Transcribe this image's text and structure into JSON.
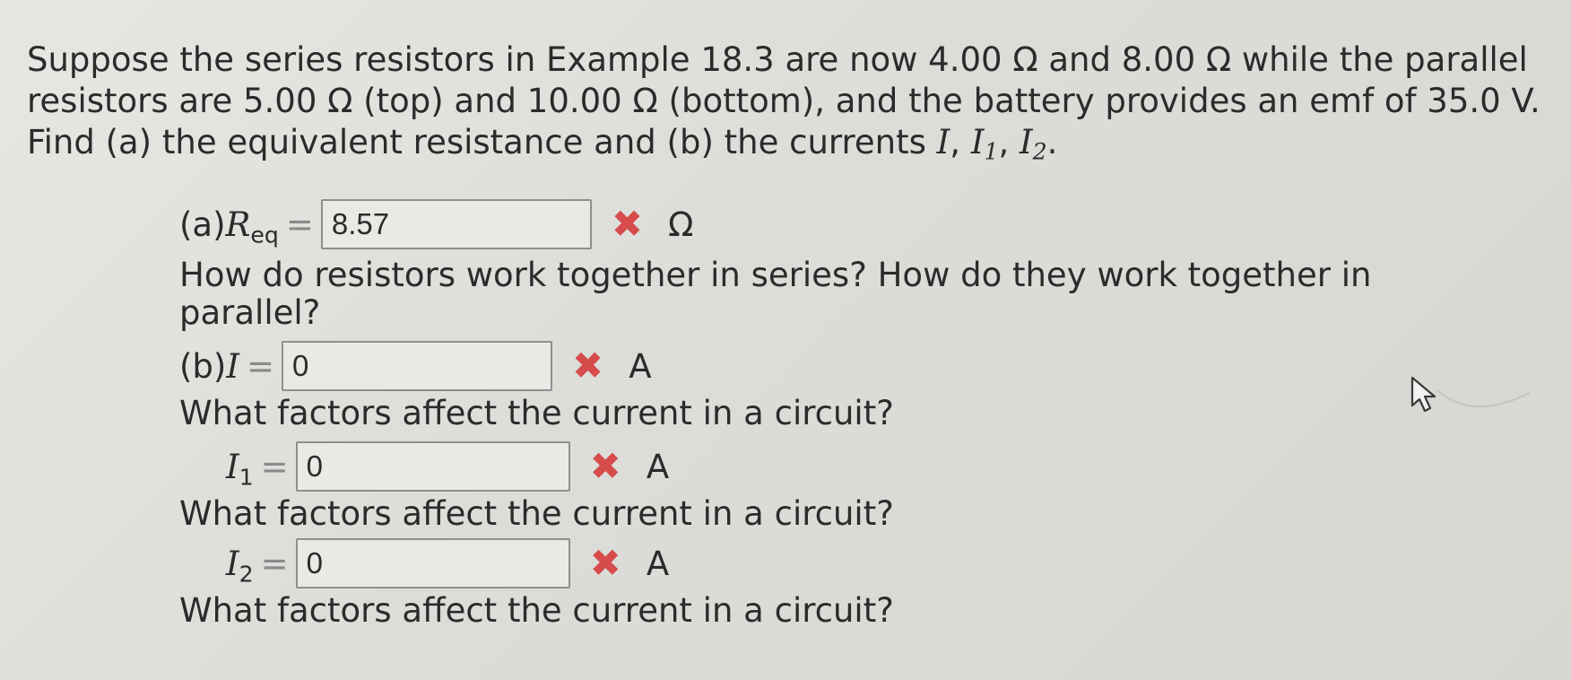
{
  "problem": {
    "text_main": "Suppose the series resistors in Example 18.3 are now 4.00 Ω and 8.00 Ω while the parallel resistors are 5.00 Ω (top) and 10.00 Ω (bottom), and the battery provides an emf of 35.0 V. Find (a) the equivalent resistance and (b) the currents ",
    "var_I": "I",
    "sep1": ", ",
    "var_I1": "I",
    "sub_1": "1",
    "sep2": ", ",
    "var_I2": "I",
    "sub_2": "2",
    "end": "."
  },
  "parts": [
    {
      "label": "(a) ",
      "var": "R",
      "sub": "eq",
      "equals": "=",
      "value": "8.57",
      "mark": "✖",
      "unit": "Ω",
      "hint": "How do resistors work together in series? How do they work together in parallel?"
    },
    {
      "label": "(b) ",
      "var": "I",
      "sub": "",
      "equals": "=",
      "value": "0",
      "mark": "✖",
      "unit": "A",
      "hint": "What factors affect the current in a circuit?"
    },
    {
      "label": "",
      "var": "I",
      "sub": "1",
      "equals": "=",
      "value": "0",
      "mark": "✖",
      "unit": "A",
      "hint": "What factors affect the current in a circuit?"
    },
    {
      "label": "",
      "var": "I",
      "sub": "2",
      "equals": "=",
      "value": "0",
      "mark": "✖",
      "unit": "A",
      "hint": "What factors affect the current in a circuit?"
    }
  ],
  "colors": {
    "incorrect_mark": "#d64b4b",
    "text": "#2b2b2b",
    "input_border": "#8f8f8f"
  },
  "icons": {
    "cursor": "mouse-pointer-icon",
    "incorrect": "x-mark-icon"
  }
}
